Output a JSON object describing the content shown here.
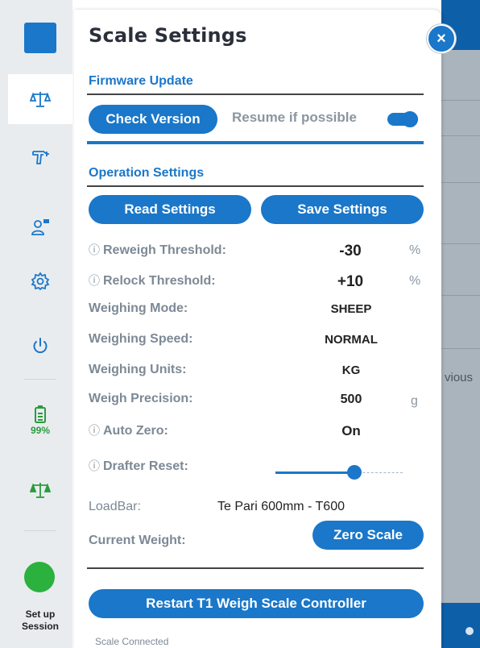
{
  "rail": {
    "items": [
      {
        "icon": "app-logo-icon",
        "active": false
      },
      {
        "icon": "scale-icon",
        "active": true
      },
      {
        "icon": "spray-gun-icon",
        "active": false
      },
      {
        "icon": "user-tag-icon",
        "active": false
      },
      {
        "icon": "gear-icon",
        "active": false
      },
      {
        "icon": "power-icon",
        "active": false
      },
      {
        "icon": "battery-icon",
        "active": false
      },
      {
        "icon": "scale-connected-icon",
        "active": false
      }
    ],
    "battery_percent": "99%",
    "session_label_line1": "Set up",
    "session_label_line2": "Session",
    "colors": {
      "accent": "#1a77c9",
      "battery": "#2a9c3d",
      "session_dot": "#2bb13d"
    }
  },
  "panel": {
    "title": "Scale Settings",
    "close_label": "×",
    "firmware": {
      "heading": "Firmware Update",
      "check_version_label": "Check Version",
      "resume_label": "Resume if possible",
      "resume_enabled": true
    },
    "operation": {
      "heading": "Operation Settings",
      "read_label": "Read Settings",
      "save_label": "Save Settings",
      "reweigh": {
        "label": "Reweigh Threshold:",
        "value": "-30",
        "unit": "%"
      },
      "relock": {
        "label": "Relock Threshold:",
        "value": "+10",
        "unit": "%"
      },
      "mode": {
        "label": "Weighing Mode:",
        "value": "SHEEP"
      },
      "speed": {
        "label": "Weighing Speed:",
        "value": "NORMAL"
      },
      "units": {
        "label": "Weighing Units:",
        "value": "KG"
      },
      "precision": {
        "label": "Weigh Precision:",
        "value": "500",
        "unit": "g"
      },
      "auto_zero": {
        "label": "Auto Zero:",
        "value": "On"
      },
      "drafter_reset": {
        "label": "Drafter Reset:",
        "level": 0.62
      },
      "loadbar": {
        "label": "LoadBar:",
        "value": "Te Pari 600mm - T600"
      },
      "current_weight": {
        "label": "Current Weight:",
        "zero_label": "Zero Scale"
      }
    },
    "info_symbol": "ⓘ",
    "restart_label": "Restart T1 Weigh Scale Controller",
    "status_text": "Scale Connected"
  },
  "background": {
    "partial_text": "vious"
  }
}
